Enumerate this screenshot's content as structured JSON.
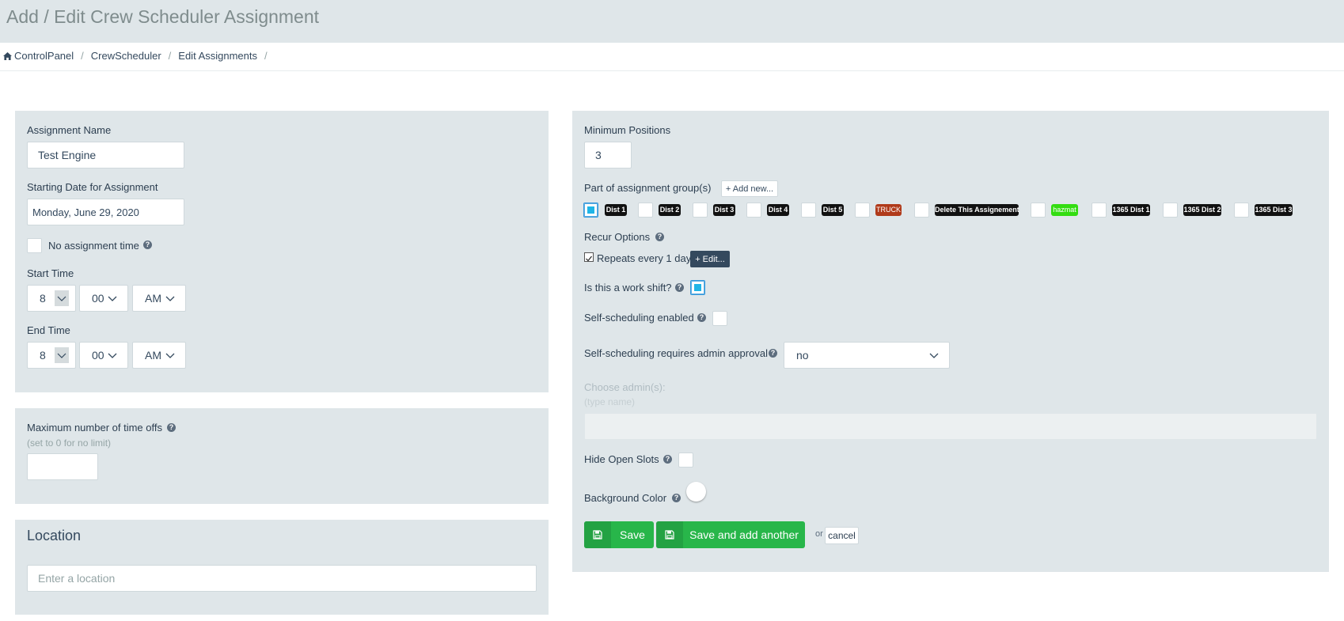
{
  "header": {
    "title": "Add / Edit Crew Scheduler Assignment"
  },
  "breadcrumb": {
    "items": [
      "ControlPanel",
      "CrewScheduler",
      "Edit Assignments"
    ]
  },
  "assignment_name": {
    "label": "Assignment Name",
    "value": "Test Engine"
  },
  "starting_date": {
    "label": "Starting Date for Assignment",
    "value": "Monday, June 29, 2020"
  },
  "no_assignment_time": {
    "label": "No assignment time"
  },
  "start_time": {
    "label": "Start Time",
    "hour": "8",
    "minute": "00",
    "ampm": "AM"
  },
  "end_time": {
    "label": "End Time",
    "hour": "8",
    "minute": "00",
    "ampm": "AM"
  },
  "time_offs": {
    "label": "Maximum number of time offs",
    "hint": "(set to 0 for no limit)",
    "value": ""
  },
  "location": {
    "title": "Location",
    "placeholder": "Enter a location"
  },
  "min_positions": {
    "label": "Minimum Positions",
    "value": "3"
  },
  "groups": {
    "label": "Part of assignment group(s)",
    "add_new": "+ Add new...",
    "items": [
      {
        "label": "Dist 1",
        "checked": true
      },
      {
        "label": "Dist 2",
        "checked": false
      },
      {
        "label": "Dist 3",
        "checked": false
      },
      {
        "label": "Dist 4",
        "checked": false
      },
      {
        "label": "Dist 5",
        "checked": false
      },
      {
        "label": "TRUCK",
        "checked": false,
        "color": "#b03a1a"
      },
      {
        "label": "Delete This Assignement",
        "checked": false
      },
      {
        "label": "hazmat",
        "checked": false,
        "color": "#33dd11"
      },
      {
        "label": "1365 Dist 1",
        "checked": false
      },
      {
        "label": "1365 Dist 2",
        "checked": false
      },
      {
        "label": "1365 Dist 3",
        "checked": false
      }
    ]
  },
  "recur": {
    "label": "Recur Options",
    "repeats": "Repeats every 1 days",
    "edit": "+ Edit..."
  },
  "work_shift": {
    "label": "Is this a work shift?",
    "checked": true
  },
  "self_scheduling": {
    "label": "Self-scheduling enabled",
    "checked": false
  },
  "admin_approval": {
    "label": "Self-scheduling requires admin approval",
    "value": "no"
  },
  "choose_admins": {
    "label": "Choose admin(s):",
    "hint": "(type name)"
  },
  "hide_open_slots": {
    "label": "Hide Open Slots",
    "checked": false
  },
  "background_color": {
    "label": "Background Color",
    "value": "#ffffff"
  },
  "actions": {
    "save": "Save",
    "save_add": "Save and add another",
    "or": "or",
    "cancel": "cancel"
  },
  "colors": {
    "panel": "#dfe6e9",
    "green": "#28b64a",
    "dark": "#34495e"
  }
}
